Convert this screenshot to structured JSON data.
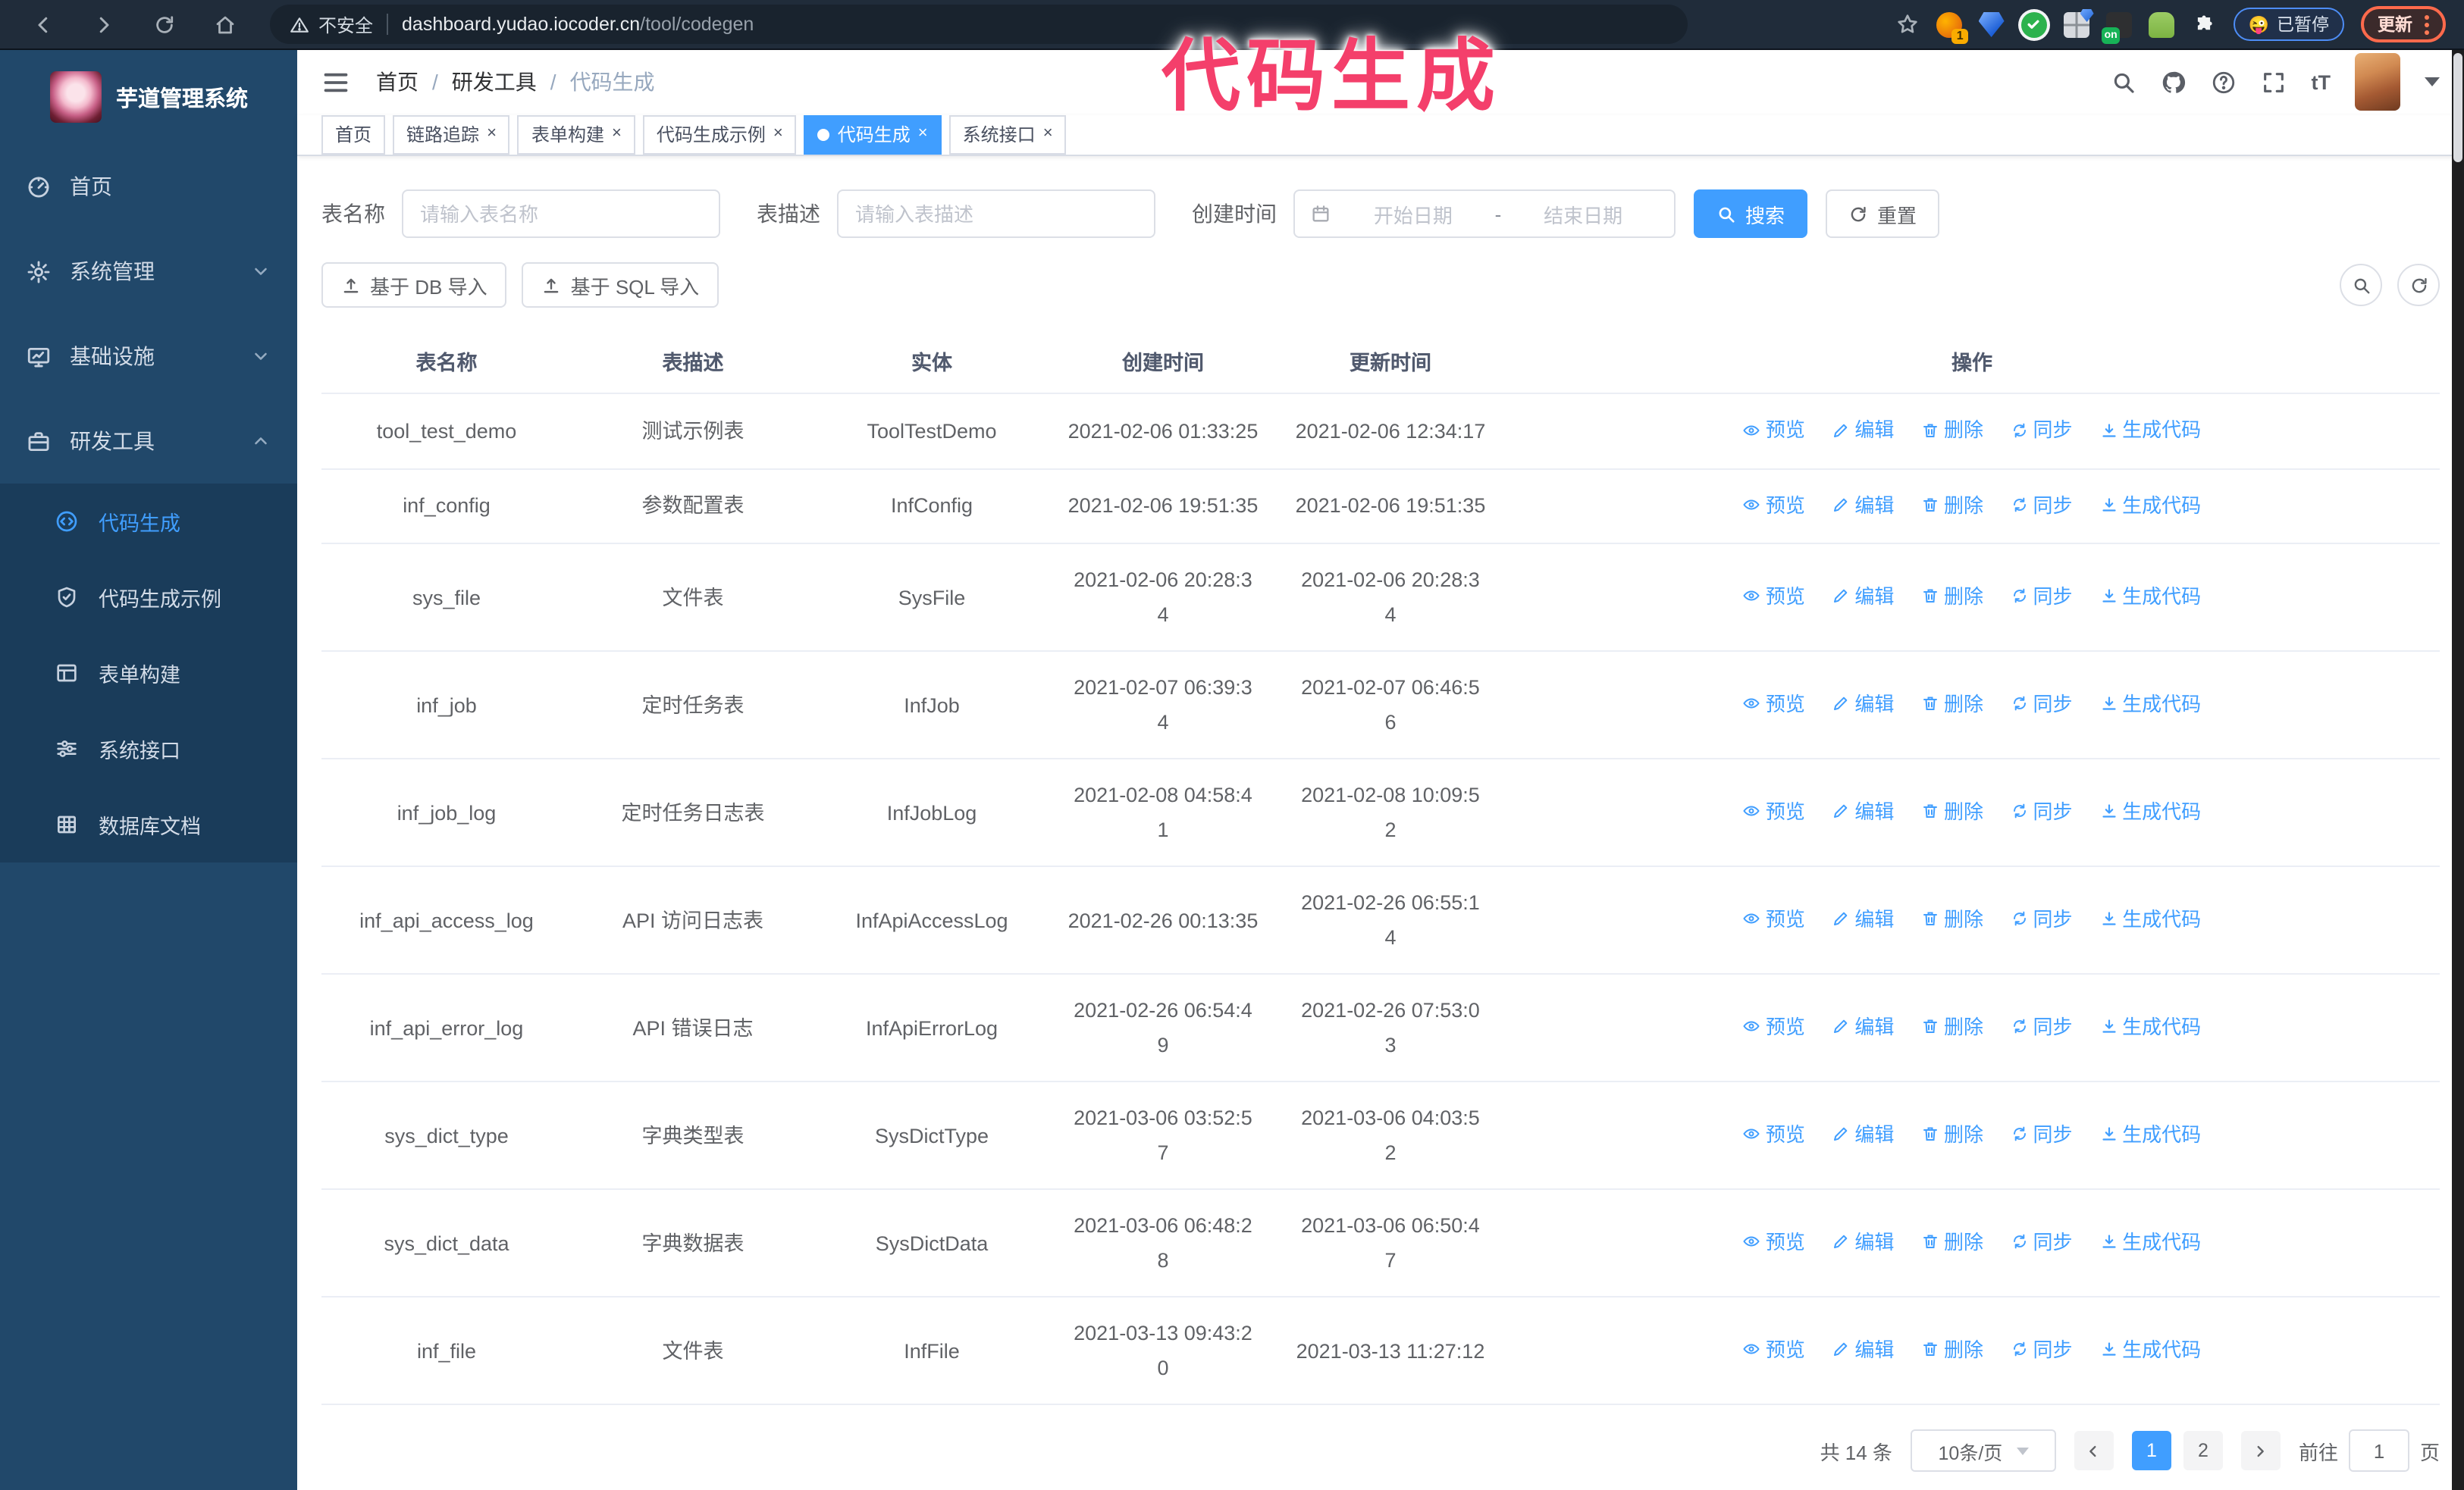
{
  "browser": {
    "security_label": "不安全",
    "url_host": "dashboard.yudao.iocoder.cn",
    "url_path": "/tool/codegen",
    "ext_badge_count": "1",
    "ext_badge_on": "on",
    "paused_emoji": "😜",
    "paused_label": "已暂停",
    "update_label": "更新"
  },
  "watermark_text": "代码生成",
  "sidebar": {
    "logo_title": "芋道管理系统",
    "items": [
      {
        "label": "首页"
      },
      {
        "label": "系统管理"
      },
      {
        "label": "基础设施"
      },
      {
        "label": "研发工具"
      }
    ],
    "submenu": [
      {
        "label": "代码生成",
        "active": true
      },
      {
        "label": "代码生成示例"
      },
      {
        "label": "表单构建"
      },
      {
        "label": "系统接口"
      },
      {
        "label": "数据库文档"
      }
    ]
  },
  "header": {
    "breadcrumb": [
      "首页",
      "研发工具",
      "代码生成"
    ],
    "breadcrumb_separator": "/",
    "font_size_glyph": "tT"
  },
  "tabs": [
    {
      "label": "首页",
      "closable": false,
      "active": false
    },
    {
      "label": "链路追踪",
      "closable": true,
      "active": false
    },
    {
      "label": "表单构建",
      "closable": true,
      "active": false
    },
    {
      "label": "代码生成示例",
      "closable": true,
      "active": false
    },
    {
      "label": "代码生成",
      "closable": true,
      "active": true
    },
    {
      "label": "系统接口",
      "closable": true,
      "active": false
    }
  ],
  "ui": {
    "close_glyph": "×"
  },
  "filters": {
    "table_name_label": "表名称",
    "table_name_placeholder": "请输入表名称",
    "table_desc_label": "表描述",
    "table_desc_placeholder": "请输入表描述",
    "create_time_label": "创建时间",
    "date_start_placeholder": "开始日期",
    "date_separator": "-",
    "date_end_placeholder": "结束日期",
    "search_button": "搜索",
    "reset_button": "重置"
  },
  "toolbar": {
    "import_db": "基于 DB 导入",
    "import_sql": "基于 SQL 导入"
  },
  "table": {
    "columns": [
      "表名称",
      "表描述",
      "实体",
      "创建时间",
      "更新时间",
      "操作"
    ],
    "actions": [
      "预览",
      "编辑",
      "删除",
      "同步",
      "生成代码"
    ],
    "rows": [
      {
        "name": "tool_test_demo",
        "desc": "测试示例表",
        "entity": "ToolTestDemo",
        "created": "2021-02-06 01:33:25",
        "updated": "2021-02-06 12:34:17"
      },
      {
        "name": "inf_config",
        "desc": "参数配置表",
        "entity": "InfConfig",
        "created": "2021-02-06 19:51:35",
        "updated": "2021-02-06 19:51:35"
      },
      {
        "name": "sys_file",
        "desc": "文件表",
        "entity": "SysFile",
        "created": "2021-02-06 20:28:3\n4",
        "updated": "2021-02-06 20:28:3\n4"
      },
      {
        "name": "inf_job",
        "desc": "定时任务表",
        "entity": "InfJob",
        "created": "2021-02-07 06:39:3\n4",
        "updated": "2021-02-07 06:46:5\n6"
      },
      {
        "name": "inf_job_log",
        "desc": "定时任务日志表",
        "entity": "InfJobLog",
        "created": "2021-02-08 04:58:4\n1",
        "updated": "2021-02-08 10:09:5\n2"
      },
      {
        "name": "inf_api_access_log",
        "desc": "API 访问日志表",
        "entity": "InfApiAccessLog",
        "created": "2021-02-26 00:13:35",
        "updated": "2021-02-26 06:55:1\n4"
      },
      {
        "name": "inf_api_error_log",
        "desc": "API 错误日志",
        "entity": "InfApiErrorLog",
        "created": "2021-02-26 06:54:4\n9",
        "updated": "2021-02-26 07:53:0\n3"
      },
      {
        "name": "sys_dict_type",
        "desc": "字典类型表",
        "entity": "SysDictType",
        "created": "2021-03-06 03:52:5\n7",
        "updated": "2021-03-06 04:03:5\n2"
      },
      {
        "name": "sys_dict_data",
        "desc": "字典数据表",
        "entity": "SysDictData",
        "created": "2021-03-06 06:48:2\n8",
        "updated": "2021-03-06 06:50:4\n7"
      },
      {
        "name": "inf_file",
        "desc": "文件表",
        "entity": "InfFile",
        "created": "2021-03-13 09:43:2\n0",
        "updated": "2021-03-13 11:27:12"
      }
    ]
  },
  "pagination": {
    "total": "共 14 条",
    "page_size": "10条/页",
    "pages": [
      {
        "label": "1",
        "active": true
      },
      {
        "label": "2",
        "active": false
      }
    ],
    "goto_label": "前往",
    "goto_value": "1",
    "goto_unit": "页"
  },
  "colors": {
    "accent": "#409eff",
    "sidebar_bg": "#21486a",
    "submenu_bg": "#1a3c5a",
    "watermark": "#f43f6b",
    "chrome_bg": "#202c3a"
  }
}
